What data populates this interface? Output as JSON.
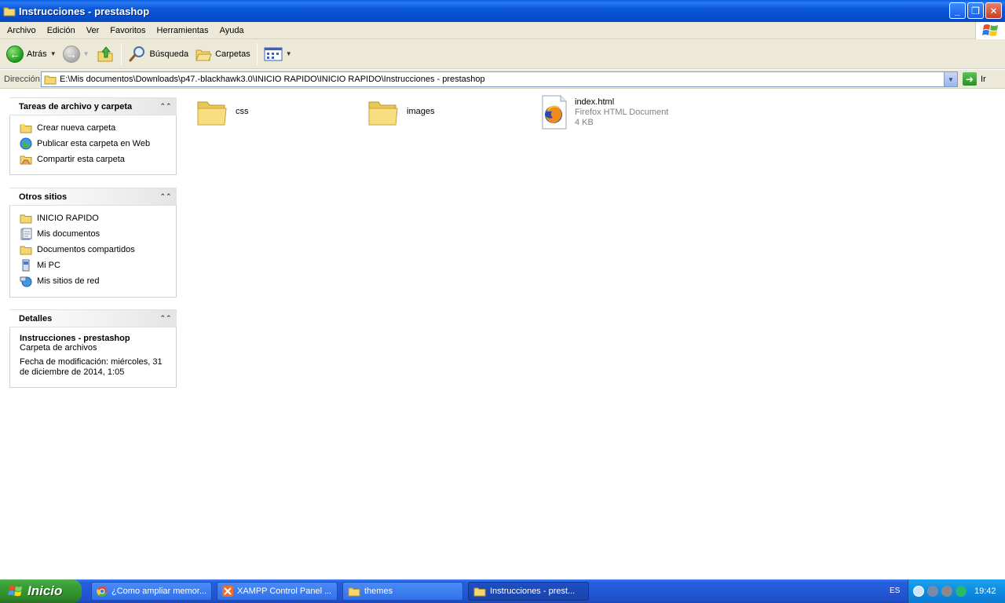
{
  "window": {
    "title": "Instrucciones - prestashop",
    "controls": {
      "minimize": "_",
      "restore": "❐",
      "close": "✕"
    }
  },
  "menu": [
    "Archivo",
    "Edición",
    "Ver",
    "Favoritos",
    "Herramientas",
    "Ayuda"
  ],
  "toolbar": {
    "back_label": "Atrás",
    "search_label": "Búsqueda",
    "folders_label": "Carpetas"
  },
  "address": {
    "label": "Dirección",
    "path": "E:\\Mis documentos\\Downloads\\p47.-blackhawk3.0\\INICIO RAPIDO\\INICIO RAPIDO\\Instrucciones - prestashop",
    "go_label": "Ir"
  },
  "tasks_panel": {
    "title": "Tareas de archivo y carpeta",
    "items": [
      "Crear nueva carpeta",
      "Publicar esta carpeta en Web",
      "Compartir esta carpeta"
    ]
  },
  "places_panel": {
    "title": "Otros sitios",
    "items": [
      "INICIO RAPIDO",
      "Mis documentos",
      "Documentos compartidos",
      "Mi PC",
      "Mis sitios de red"
    ]
  },
  "details_panel": {
    "title": "Detalles",
    "name": "Instrucciones - prestashop",
    "type": "Carpeta de archivos",
    "modified_line1": "Fecha de modificación: miércoles, 31",
    "modified_line2": "de diciembre de 2014, 1:05"
  },
  "files": [
    {
      "name": "css",
      "kind": "folder"
    },
    {
      "name": "images",
      "kind": "folder"
    },
    {
      "name": "index.html",
      "kind": "file",
      "type": "Firefox HTML Document",
      "size": "4 KB"
    }
  ],
  "taskbar": {
    "start_label": "Inicio",
    "buttons": [
      "¿Como ampliar memor...",
      "XAMPP Control Panel ...",
      "themes",
      "Instrucciones - prest..."
    ],
    "language": "ES",
    "clock": "19:42"
  },
  "colors": {
    "titlebar": "#0550d0",
    "chrome": "#ece9d8",
    "folder": "#f4d774",
    "taskbar": "#2458d6",
    "start": "#3ca23a"
  }
}
